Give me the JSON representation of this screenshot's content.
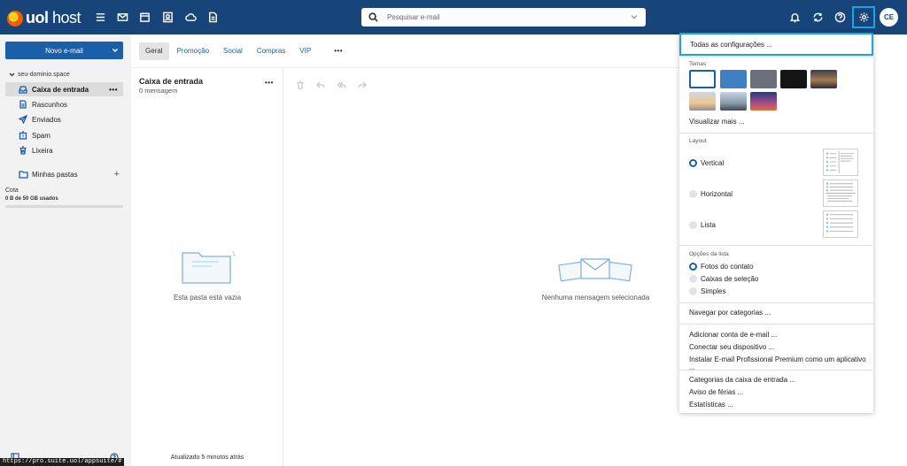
{
  "app": {
    "logo_brand": "uol",
    "logo_product": "host"
  },
  "search": {
    "placeholder": "Pesquisar e-mail"
  },
  "user": {
    "initials": "CE"
  },
  "sidebar": {
    "new_email_label": "Novo e-mail",
    "domain": "seu-dominio.space",
    "folders": [
      {
        "label": "Caixa de entrada",
        "icon": "inbox-icon",
        "active": true
      },
      {
        "label": "Rascunhos",
        "icon": "draft-icon"
      },
      {
        "label": "Enviados",
        "icon": "send-icon"
      },
      {
        "label": "Spam",
        "icon": "spam-icon"
      },
      {
        "label": "Lixeira",
        "icon": "trash-icon"
      }
    ],
    "my_folders_label": "Minhas pastas",
    "quota_label": "Cota",
    "quota_usage": "0 B de 50 GB usados",
    "quota_fraction": 0
  },
  "tabs": [
    "Geral",
    "Promoção",
    "Social",
    "Compras",
    "VIP"
  ],
  "list": {
    "title": "Caixa de entrada",
    "count": "0 mensagem",
    "empty_text": "Esta pasta está vazia",
    "updated": "Atualizado 5 minutos atrás"
  },
  "reading": {
    "empty_text": "Nenhuma mensagem selecionada"
  },
  "settings": {
    "all_settings": "Todas as configurações ...",
    "themes_label": "Temas",
    "see_more": "Visualizar mais ...",
    "layout_label": "Layout",
    "layout_options": [
      "Vertical",
      "Horizontal",
      "Lista"
    ],
    "layout_selected": "Vertical",
    "list_options_label": "Opções da lista",
    "list_options": [
      "Fotos do contato",
      "Caixas de seleção",
      "Simples"
    ],
    "list_option_selected": "Fotos do contato",
    "browse_categories": "Navegar por categorias ...",
    "add_account": "Adicionar conta de e-mail ...",
    "connect_device": "Conectar seu dispositivo ...",
    "install_premium": "Instalar E-mail Profissional Premium como um aplicativo ...",
    "inbox_categories": "Categorias da caixa de entrada ...",
    "vacation": "Aviso de férias ...",
    "statistics": "Estatísticas ..."
  },
  "status_url": "https://pro.suite.uol/appsuite/#",
  "colors": {
    "header": "#17457a",
    "accent": "#1b5fa8",
    "focus": "#1ba3e2"
  }
}
